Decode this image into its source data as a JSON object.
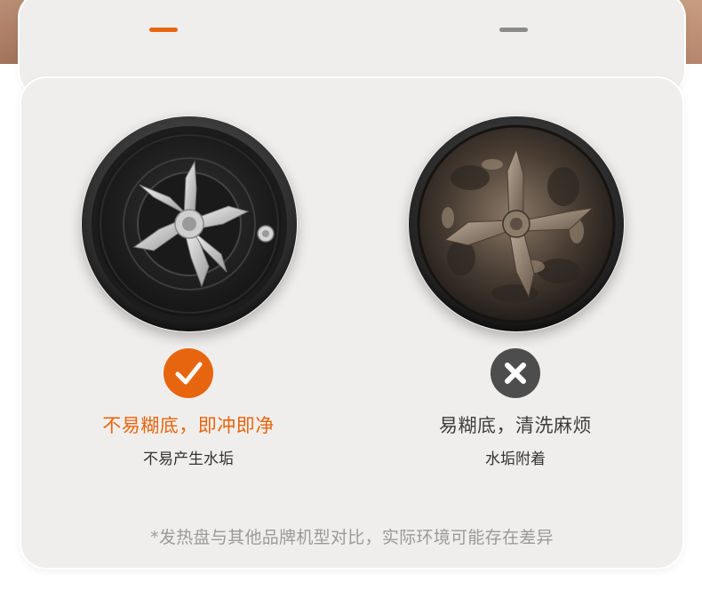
{
  "colors": {
    "accent": "#e8650f",
    "neutral": "#4d4d4d",
    "tab_inactive": "#8a8a8a",
    "card_bg": "#f0eeec",
    "footnote": "#9a9a9a"
  },
  "tabs": [
    {
      "state": "active"
    },
    {
      "state": "inactive"
    }
  ],
  "comparison": {
    "good": {
      "image": "clean-blade-base-image",
      "badge_icon": "checkmark-icon",
      "title": "不易糊底，即冲即净",
      "subtitle": "不易产生水垢"
    },
    "bad": {
      "image": "dirty-blade-base-image",
      "badge_icon": "x-icon",
      "title": "易糊底，清洗麻烦",
      "subtitle": "水垢附着"
    }
  },
  "footnote": "*发热盘与其他品牌机型对比，实际环境可能存在差异"
}
